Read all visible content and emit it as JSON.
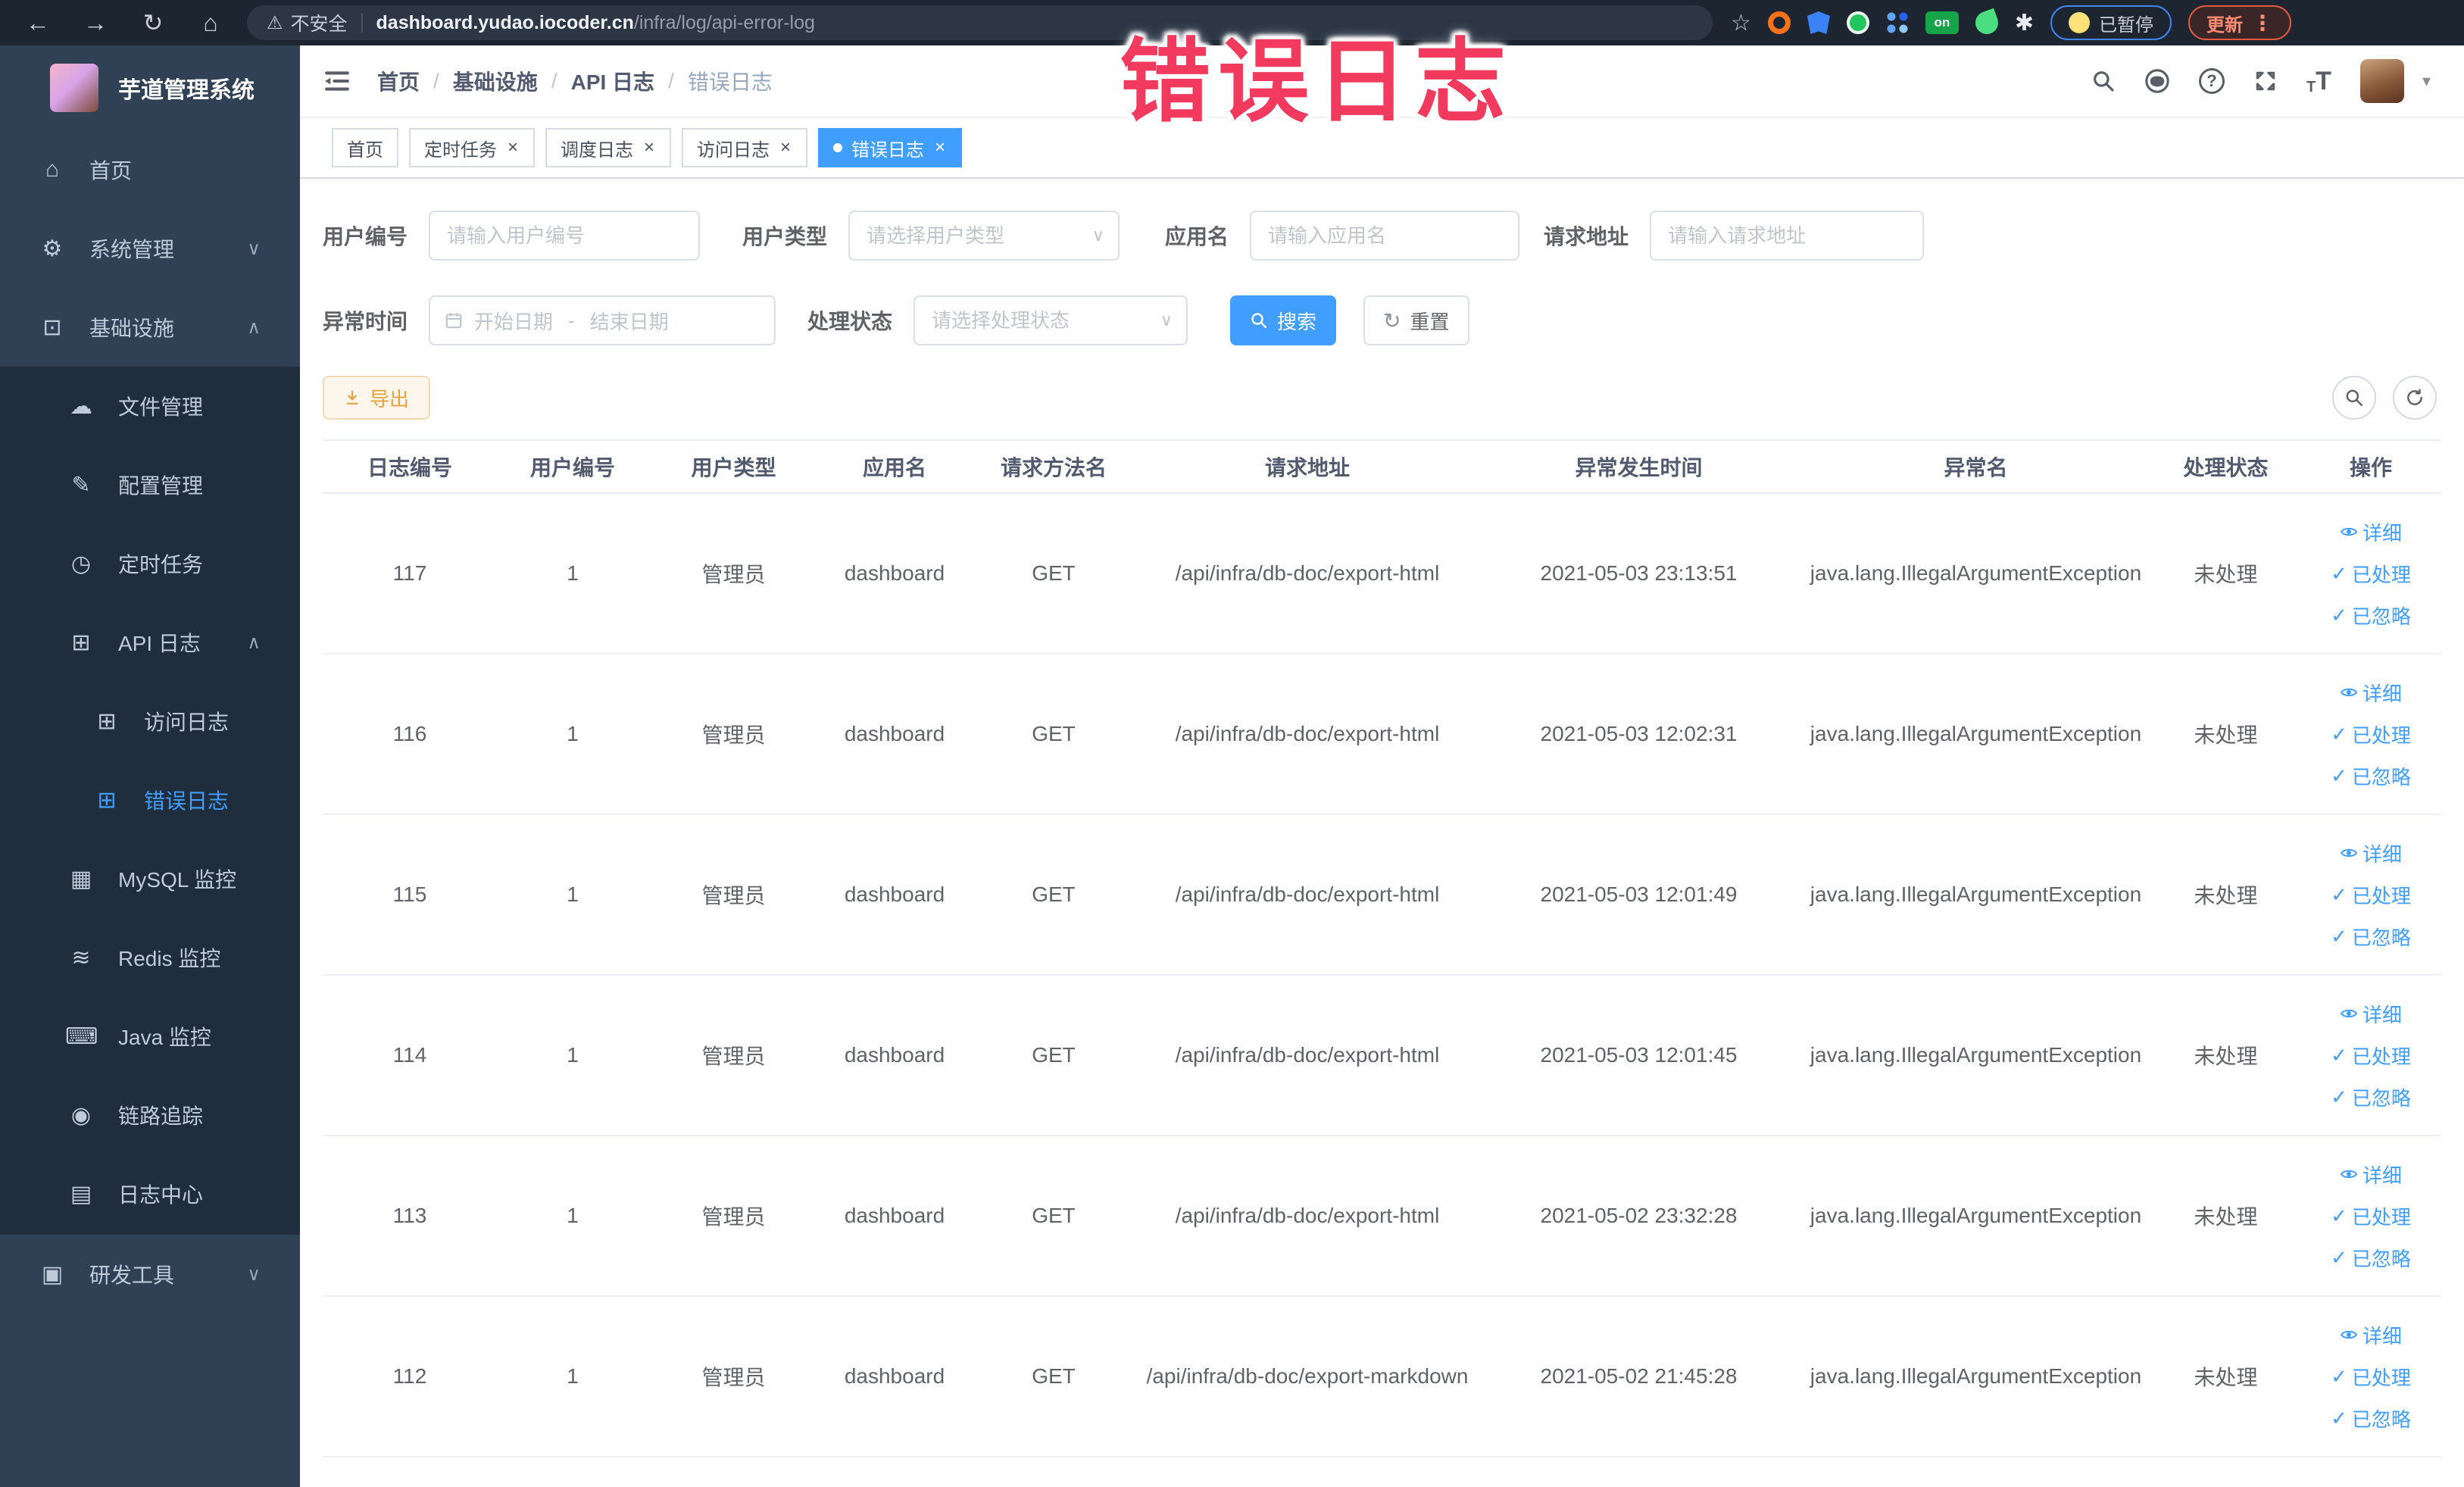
{
  "browser": {
    "security_label": "不安全",
    "url_host": "dashboard.yudao.iocoder.cn",
    "url_path": "/infra/log/api-error-log",
    "extension_badge": "on",
    "paused_badge": "已暂停",
    "update_badge": "更新"
  },
  "overlay": {
    "text": "错误日志",
    "color": "#f23a5f"
  },
  "sidebar": {
    "title": "芋道管理系统",
    "items": [
      {
        "key": "home",
        "icon": "home",
        "label": "首页",
        "level": 1,
        "section": "top"
      },
      {
        "key": "system",
        "icon": "gear",
        "label": "系统管理",
        "level": 1,
        "section": "top",
        "arrow": "down"
      },
      {
        "key": "infra",
        "icon": "monitor",
        "label": "基础设施",
        "level": 1,
        "section": "top",
        "arrow": "up"
      },
      {
        "key": "file-manage",
        "icon": "cloud",
        "label": "文件管理",
        "level": 2,
        "section": "sub"
      },
      {
        "key": "config-manage",
        "icon": "edit",
        "label": "配置管理",
        "level": 2,
        "section": "sub"
      },
      {
        "key": "scheduled-job",
        "icon": "timer",
        "label": "定时任务",
        "level": 2,
        "section": "sub"
      },
      {
        "key": "api-log",
        "icon": "api",
        "label": "API 日志",
        "level": 2,
        "section": "sub",
        "arrow": "up"
      },
      {
        "key": "access-log",
        "icon": "log",
        "label": "访问日志",
        "level": 3,
        "section": "sub"
      },
      {
        "key": "error-log",
        "icon": "log",
        "label": "错误日志",
        "level": 3,
        "section": "sub",
        "active": true
      },
      {
        "key": "mysql-monitor",
        "icon": "mysql",
        "label": "MySQL 监控",
        "level": 2,
        "section": "sub"
      },
      {
        "key": "redis-monitor",
        "icon": "redis",
        "label": "Redis 监控",
        "level": 2,
        "section": "sub"
      },
      {
        "key": "java-monitor",
        "icon": "java",
        "label": "Java 监控",
        "level": 2,
        "section": "sub"
      },
      {
        "key": "trace",
        "icon": "trace",
        "label": "链路追踪",
        "level": 2,
        "section": "sub"
      },
      {
        "key": "log-center",
        "icon": "logcenter",
        "label": "日志中心",
        "level": 2,
        "section": "sub"
      },
      {
        "key": "dev-tools",
        "icon": "tools",
        "label": "研发工具",
        "level": 1,
        "section": "bottom",
        "arrow": "down"
      }
    ]
  },
  "breadcrumb": {
    "items": [
      "首页",
      "基础设施",
      "API 日志",
      "错误日志"
    ]
  },
  "tabs": [
    {
      "label": "首页",
      "closable": false,
      "active": false
    },
    {
      "label": "定时任务",
      "closable": true,
      "active": false
    },
    {
      "label": "调度日志",
      "closable": true,
      "active": false
    },
    {
      "label": "访问日志",
      "closable": true,
      "active": false
    },
    {
      "label": "错误日志",
      "closable": true,
      "active": true
    }
  ],
  "filters": {
    "user_id": {
      "label": "用户编号",
      "placeholder": "请输入用户编号"
    },
    "user_type": {
      "label": "用户类型",
      "placeholder": "请选择用户类型"
    },
    "app_name": {
      "label": "应用名",
      "placeholder": "请输入应用名"
    },
    "request_url": {
      "label": "请求地址",
      "placeholder": "请输入请求地址"
    },
    "exception_time": {
      "label": "异常时间",
      "start_placeholder": "开始日期",
      "separator": "-",
      "end_placeholder": "结束日期"
    },
    "process_status": {
      "label": "处理状态",
      "placeholder": "请选择处理状态"
    },
    "search_label": "搜索",
    "reset_label": "重置"
  },
  "toolbar": {
    "export_label": "导出"
  },
  "table": {
    "columns": [
      "日志编号",
      "用户编号",
      "用户类型",
      "应用名",
      "请求方法名",
      "请求地址",
      "异常发生时间",
      "异常名",
      "处理状态",
      "操作"
    ],
    "actions": [
      "详细",
      "已处理",
      "已忽略"
    ],
    "rows": [
      {
        "id": "117",
        "user_id": "1",
        "user_type": "管理员",
        "app": "dashboard",
        "method": "GET",
        "url": "/api/infra/db-doc/export-html",
        "time": "2021-05-03 23:13:51",
        "exception": "java.lang.IllegalArgumentException",
        "status": "未处理"
      },
      {
        "id": "116",
        "user_id": "1",
        "user_type": "管理员",
        "app": "dashboard",
        "method": "GET",
        "url": "/api/infra/db-doc/export-html",
        "time": "2021-05-03 12:02:31",
        "exception": "java.lang.IllegalArgumentException",
        "status": "未处理"
      },
      {
        "id": "115",
        "user_id": "1",
        "user_type": "管理员",
        "app": "dashboard",
        "method": "GET",
        "url": "/api/infra/db-doc/export-html",
        "time": "2021-05-03 12:01:49",
        "exception": "java.lang.IllegalArgumentException",
        "status": "未处理"
      },
      {
        "id": "114",
        "user_id": "1",
        "user_type": "管理员",
        "app": "dashboard",
        "method": "GET",
        "url": "/api/infra/db-doc/export-html",
        "time": "2021-05-03 12:01:45",
        "exception": "java.lang.IllegalArgumentException",
        "status": "未处理"
      },
      {
        "id": "113",
        "user_id": "1",
        "user_type": "管理员",
        "app": "dashboard",
        "method": "GET",
        "url": "/api/infra/db-doc/export-html",
        "time": "2021-05-02 23:32:28",
        "exception": "java.lang.IllegalArgumentException",
        "status": "未处理"
      },
      {
        "id": "112",
        "user_id": "1",
        "user_type": "管理员",
        "app": "dashboard",
        "method": "GET",
        "url": "/api/infra/db-doc/export-markdown",
        "time": "2021-05-02 21:45:28",
        "exception": "java.lang.IllegalArgumentException",
        "status": "未处理"
      }
    ]
  }
}
